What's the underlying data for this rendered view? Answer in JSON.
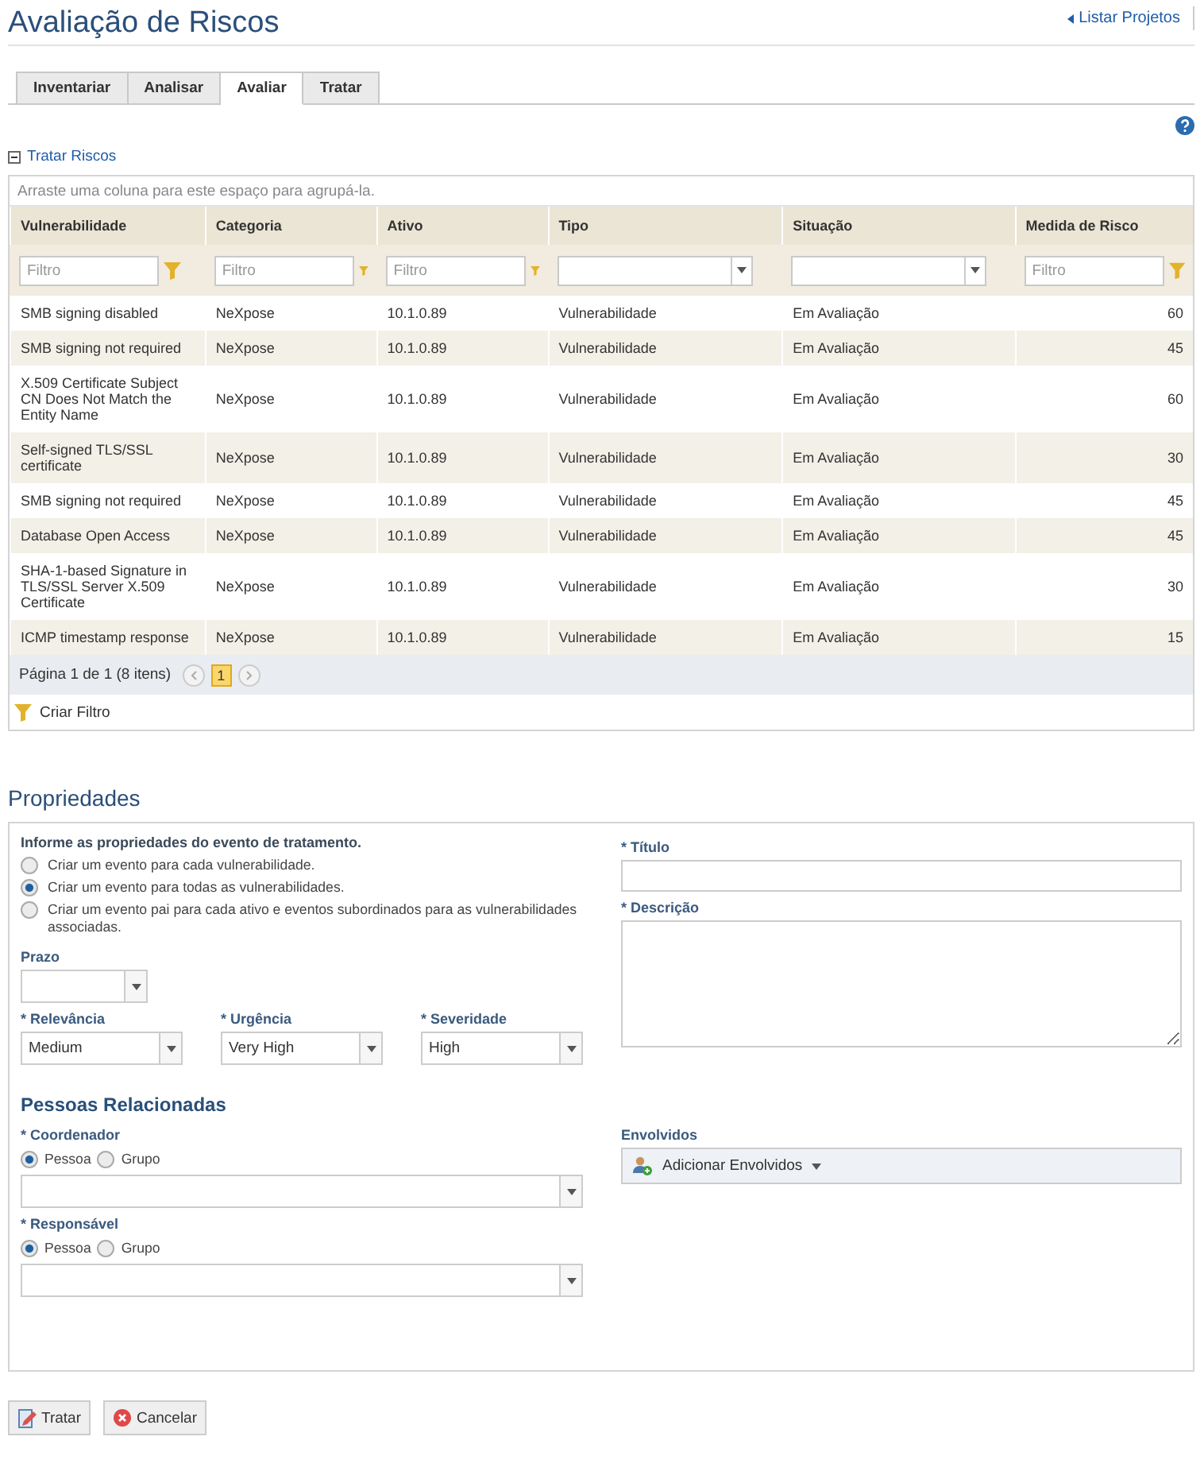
{
  "header": {
    "title": "Avaliação de Riscos",
    "back_link": "Listar Projetos"
  },
  "tabs": [
    {
      "label": "Inventariar",
      "selected": false
    },
    {
      "label": "Analisar",
      "selected": false
    },
    {
      "label": "Avaliar",
      "selected": true
    },
    {
      "label": "Tratar",
      "selected": false
    }
  ],
  "section": {
    "title": "Tratar Riscos",
    "expanded": true
  },
  "grid": {
    "group_hint": "Arraste uma coluna para este espaço para agrupá-la.",
    "columns": [
      {
        "label": "Vulnerabilidade",
        "filter": {
          "kind": "text",
          "placeholder": "Filtro"
        }
      },
      {
        "label": "Categoria",
        "filter": {
          "kind": "text",
          "placeholder": "Filtro"
        }
      },
      {
        "label": "Ativo",
        "filter": {
          "kind": "text",
          "placeholder": "Filtro"
        }
      },
      {
        "label": "Tipo",
        "filter": {
          "kind": "select"
        }
      },
      {
        "label": "Situação",
        "filter": {
          "kind": "select"
        }
      },
      {
        "label": "Medida de Risco",
        "filter": {
          "kind": "text",
          "placeholder": "Filtro"
        }
      }
    ],
    "rows": [
      [
        "SMB signing disabled",
        "NeXpose",
        "10.1.0.89",
        "Vulnerabilidade",
        "Em Avaliação",
        "60"
      ],
      [
        "SMB signing not required",
        "NeXpose",
        "10.1.0.89",
        "Vulnerabilidade",
        "Em Avaliação",
        "45"
      ],
      [
        "X.509 Certificate Subject CN Does Not Match the Entity Name",
        "NeXpose",
        "10.1.0.89",
        "Vulnerabilidade",
        "Em Avaliação",
        "60"
      ],
      [
        "Self-signed TLS/SSL certificate",
        "NeXpose",
        "10.1.0.89",
        "Vulnerabilidade",
        "Em Avaliação",
        "30"
      ],
      [
        "SMB signing not required",
        "NeXpose",
        "10.1.0.89",
        "Vulnerabilidade",
        "Em Avaliação",
        "45"
      ],
      [
        "Database Open Access",
        "NeXpose",
        "10.1.0.89",
        "Vulnerabilidade",
        "Em Avaliação",
        "45"
      ],
      [
        "SHA-1-based Signature in TLS/SSL Server X.509 Certificate",
        "NeXpose",
        "10.1.0.89",
        "Vulnerabilidade",
        "Em Avaliação",
        "30"
      ],
      [
        "ICMP timestamp response",
        "NeXpose",
        "10.1.0.89",
        "Vulnerabilidade",
        "Em Avaliação",
        "15"
      ]
    ],
    "pager": {
      "summary": "Página 1 de 1 (8 itens)",
      "pages": [
        {
          "label": "1",
          "selected": true
        }
      ]
    },
    "create_filter": "Criar Filtro"
  },
  "properties": {
    "title": "Propriedades",
    "intro": "Informe as propriedades do evento de tratamento.",
    "options": [
      {
        "label": "Criar um evento para cada vulnerabilidade.",
        "selected": false
      },
      {
        "label": "Criar um evento para todas as vulnerabilidades.",
        "selected": true
      },
      {
        "label": "Criar um evento pai para cada ativo e eventos subordinados para as vulnerabilidades associadas.",
        "selected": false
      }
    ],
    "deadline": {
      "label": "Prazo"
    },
    "selects": [
      {
        "label": "* Relevância",
        "value": "Medium"
      },
      {
        "label": "* Urgência",
        "value": "Very High"
      },
      {
        "label": "* Severidade",
        "value": "High"
      }
    ],
    "title_field": {
      "label": "* Título"
    },
    "description_field": {
      "label": "* Descrição"
    },
    "people": {
      "title": "Pessoas Relacionadas",
      "pickers": [
        {
          "label": "* Coordenador",
          "options": [
            {
              "label": "Pessoa",
              "selected": true
            },
            {
              "label": "Grupo",
              "selected": false
            }
          ]
        },
        {
          "label": "* Responsável",
          "options": [
            {
              "label": "Pessoa",
              "selected": true
            },
            {
              "label": "Grupo",
              "selected": false
            }
          ]
        }
      ],
      "involved": {
        "label": "Envolvidos",
        "button": "Adicionar Envolvidos"
      }
    }
  },
  "buttons": [
    {
      "kind": "submit",
      "label": "Tratar"
    },
    {
      "kind": "cancel",
      "label": "Cancelar"
    }
  ]
}
